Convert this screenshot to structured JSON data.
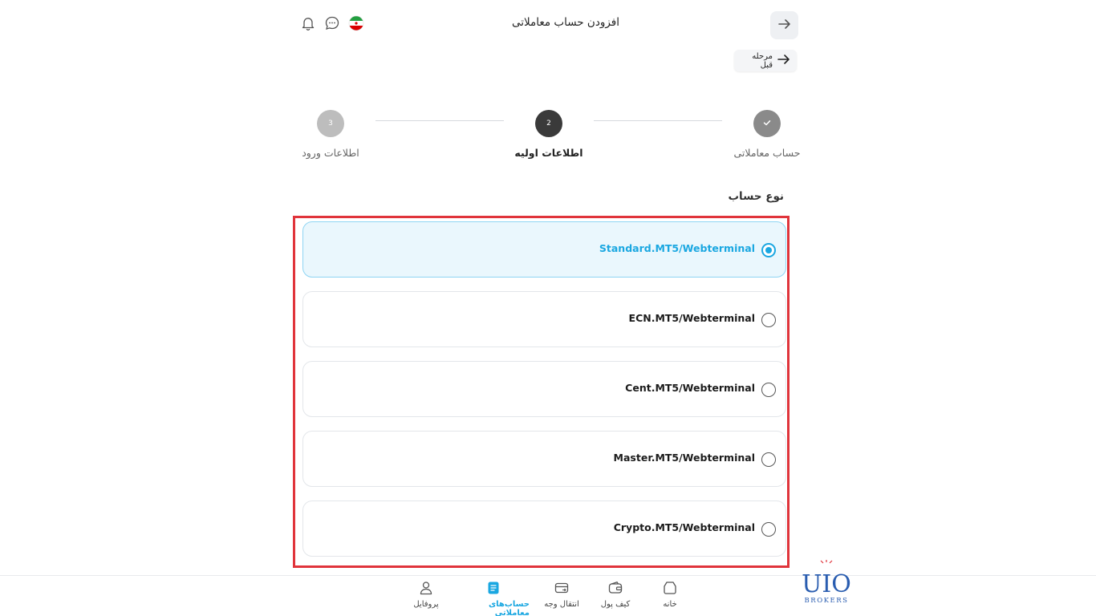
{
  "header": {
    "title": "افزودن حساب معاملاتی",
    "prev_step_label": "مرحله قبل"
  },
  "stepper": {
    "steps": [
      {
        "number": "✓",
        "label": "حساب معاملاتی",
        "state": "done"
      },
      {
        "number": "2",
        "label": "اطلاعات اولیه",
        "state": "active"
      },
      {
        "number": "3",
        "label": "اطلاعات ورود",
        "state": "pending"
      }
    ]
  },
  "account_type": {
    "label": "نوع حساب",
    "options": [
      {
        "label": "Standard.MT5/Webterminal",
        "selected": true
      },
      {
        "label": "ECN.MT5/Webterminal",
        "selected": false
      },
      {
        "label": "Cent.MT5/Webterminal",
        "selected": false
      },
      {
        "label": "Master.MT5/Webterminal",
        "selected": false
      },
      {
        "label": "Crypto.MT5/Webterminal",
        "selected": false
      }
    ]
  },
  "bottom_nav": {
    "items": [
      {
        "label": "خانه",
        "icon": "home-icon",
        "active": false
      },
      {
        "label": "کیف پول",
        "icon": "wallet-icon",
        "active": false
      },
      {
        "label": "انتقال وجه",
        "icon": "transfer-card-icon",
        "active": false
      },
      {
        "label": "حساب‌های معاملاتی",
        "icon": "accounts-list-icon",
        "active": true
      },
      {
        "label": "پروفایل",
        "icon": "profile-icon",
        "active": false
      }
    ]
  },
  "logo": {
    "main": "UIO",
    "sub": "BROKERS"
  },
  "colors": {
    "accent": "#1aa7e1",
    "highlight_frame": "#e0343b",
    "selected_bg": "#eaf7fd",
    "step_done": "#8a8a8a",
    "step_active": "#3a3a3a",
    "step_pending": "#bdbdbd"
  }
}
